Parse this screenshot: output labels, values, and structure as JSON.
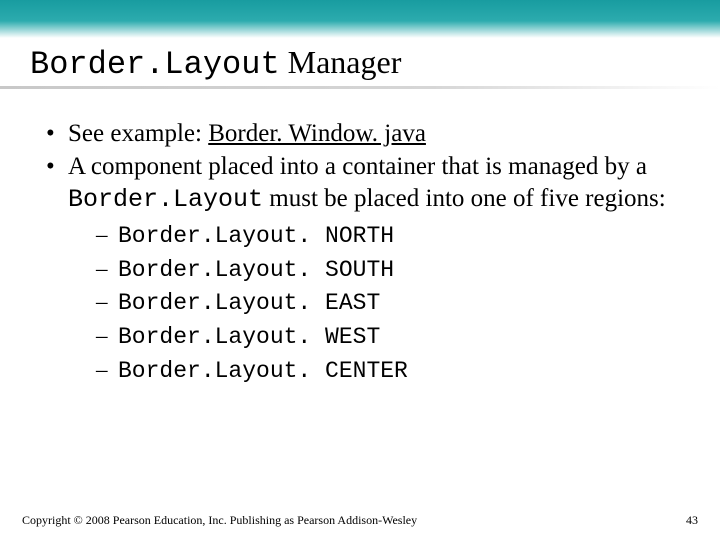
{
  "title": {
    "mono": "Border.Layout",
    "rest": " Manager"
  },
  "bullets": {
    "b1_prefix": "See example: ",
    "b1_link": "Border. Window. java",
    "b2_part1": "A component placed into a container that is managed by a ",
    "b2_mono": "Border.Layout",
    "b2_part2": " must be placed into one of five regions:"
  },
  "regions": [
    "Border.Layout. NORTH",
    "Border.Layout. SOUTH",
    "Border.Layout. EAST",
    "Border.Layout. WEST",
    "Border.Layout. CENTER"
  ],
  "footer": {
    "copyright": "Copyright © 2008 Pearson Education, Inc. Publishing as Pearson Addison-Wesley",
    "page": "43"
  }
}
